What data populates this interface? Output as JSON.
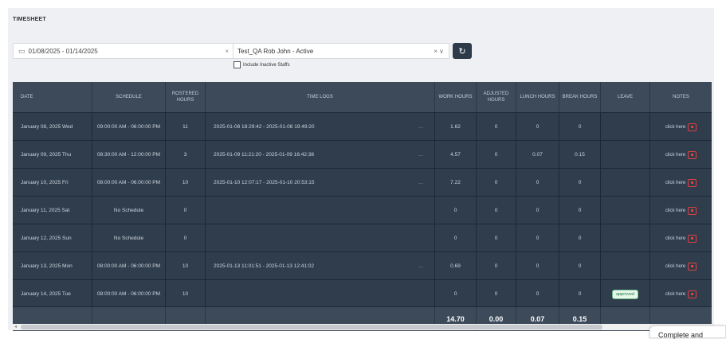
{
  "page": {
    "title": "TIMESHEET"
  },
  "filters": {
    "date_range": "01/08/2025 - 01/14/2025",
    "staff": "Test_QA Rob John - Active",
    "include_inactive_label": "Include Inactive Staffs"
  },
  "table": {
    "columns": [
      "DATE",
      "SCHEDULE",
      "ROSTERED HOURS",
      "TIME LOGS",
      "WORK HOURS",
      "ADJUSTED HOURS",
      "LUNCH HOURS",
      "BREAK HOURS",
      "LEAVE",
      "NOTES"
    ],
    "rows": [
      {
        "date": "January 08, 2025 Wed",
        "schedule": "09:00:00 AM - 06:00:00 PM",
        "rostered": "11",
        "timelog": "2025-01-08 18:29:42 - 2025-01-08 19:49:20",
        "work": "1.62",
        "adjusted": "0",
        "lunch": "0",
        "break": "0",
        "leave": "",
        "notes": "click here"
      },
      {
        "date": "January 09, 2025 Thu",
        "schedule": "08:30:00 AM - 12:00:00 PM",
        "rostered": "3",
        "timelog": "2025-01-09 11:21:20 - 2025-01-09 16:42:38",
        "work": "4.57",
        "adjusted": "0",
        "lunch": "0.07",
        "break": "0.15",
        "leave": "",
        "notes": "click here"
      },
      {
        "date": "January 10, 2025 Fri",
        "schedule": "08:00:00 AM - 06:00:00 PM",
        "rostered": "10",
        "timelog": "2025-01-10 12:07:17 - 2025-01-10 20:53:15",
        "work": "7.22",
        "adjusted": "0",
        "lunch": "0",
        "break": "0",
        "leave": "",
        "notes": "click here"
      },
      {
        "date": "January 11, 2025 Sat",
        "schedule": "No Schedule",
        "rostered": "0",
        "timelog": "",
        "work": "0",
        "adjusted": "0",
        "lunch": "0",
        "break": "0",
        "leave": "",
        "notes": "click here"
      },
      {
        "date": "January 12, 2025 Sun",
        "schedule": "No Schedule",
        "rostered": "0",
        "timelog": "",
        "work": "0",
        "adjusted": "0",
        "lunch": "0",
        "break": "0",
        "leave": "",
        "notes": "click here"
      },
      {
        "date": "January 13, 2025 Mon",
        "schedule": "08:00:00 AM - 06:00:00 PM",
        "rostered": "10",
        "timelog": "2025-01-13 11:01:51 - 2025-01-13 12:41:02",
        "work": "0.69",
        "adjusted": "0",
        "lunch": "0",
        "break": "0",
        "leave": "",
        "notes": "click here"
      },
      {
        "date": "January 14, 2025 Tue",
        "schedule": "08:00:00 AM - 06:00:00 PM",
        "rostered": "10",
        "timelog": "",
        "work": "0",
        "adjusted": "0",
        "lunch": "0",
        "break": "0",
        "leave": "approved",
        "notes": "click here"
      }
    ],
    "totals": {
      "work": "14.70",
      "adjusted": "0.00",
      "lunch": "0.07",
      "break": "0.15"
    }
  },
  "popup": {
    "text": "Complete and"
  },
  "colors": {
    "grid": "#2f3d4d",
    "header": "#3c4a5a",
    "accent": "#e14040",
    "approved": "#1f7a3e"
  }
}
